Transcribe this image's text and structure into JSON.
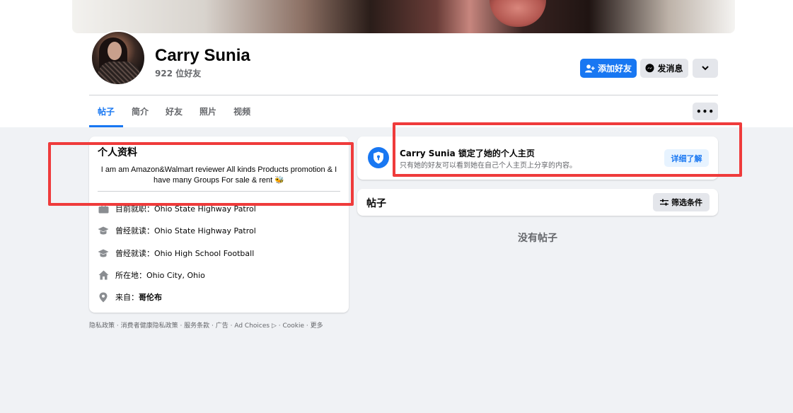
{
  "profile": {
    "name": "Carry Sunia",
    "friends_count": "922 位好友"
  },
  "actions": {
    "add_friend": "添加好友",
    "message": "发消息"
  },
  "tabs": [
    {
      "label": "帖子",
      "active": true
    },
    {
      "label": "简介",
      "active": false
    },
    {
      "label": "好友",
      "active": false
    },
    {
      "label": "照片",
      "active": false
    },
    {
      "label": "视频",
      "active": false
    }
  ],
  "intro": {
    "title": "个人资料",
    "bio": "I am am Amazon&Walmart reviewer All kinds Products promotion & I have many Groups For sale & rent 🐝",
    "rows": [
      {
        "icon": "briefcase-icon",
        "prefix": "目前就职：",
        "value": "Ohio State Highway Patrol"
      },
      {
        "icon": "graduation-cap-icon",
        "prefix": "曾经就读：",
        "value": "Ohio State Highway Patrol"
      },
      {
        "icon": "graduation-cap-icon",
        "prefix": "曾经就读：",
        "value": "Ohio High School Football"
      },
      {
        "icon": "home-icon",
        "prefix": "所在地：",
        "value": "Ohio City, Ohio"
      },
      {
        "icon": "location-pin-icon",
        "prefix": "来自：",
        "value": "哥伦布"
      }
    ]
  },
  "footer": {
    "links": "隐私政策 · 消费者健康隐私政策 · 服务条款 · 广告 · Ad Choices",
    "links_tail": " · Cookie · 更多"
  },
  "lock_notice": {
    "title": "Carry Sunia 锁定了她的个人主页",
    "subtitle": "只有她的好友可以看到她在自己个人主页上分享的内容。",
    "learn_more": "详细了解"
  },
  "posts": {
    "title": "帖子",
    "filter": "筛选条件",
    "empty": "没有帖子"
  },
  "colors": {
    "accent": "#1877f2",
    "highlight": "#ef3b3b",
    "background": "#f0f2f5"
  }
}
